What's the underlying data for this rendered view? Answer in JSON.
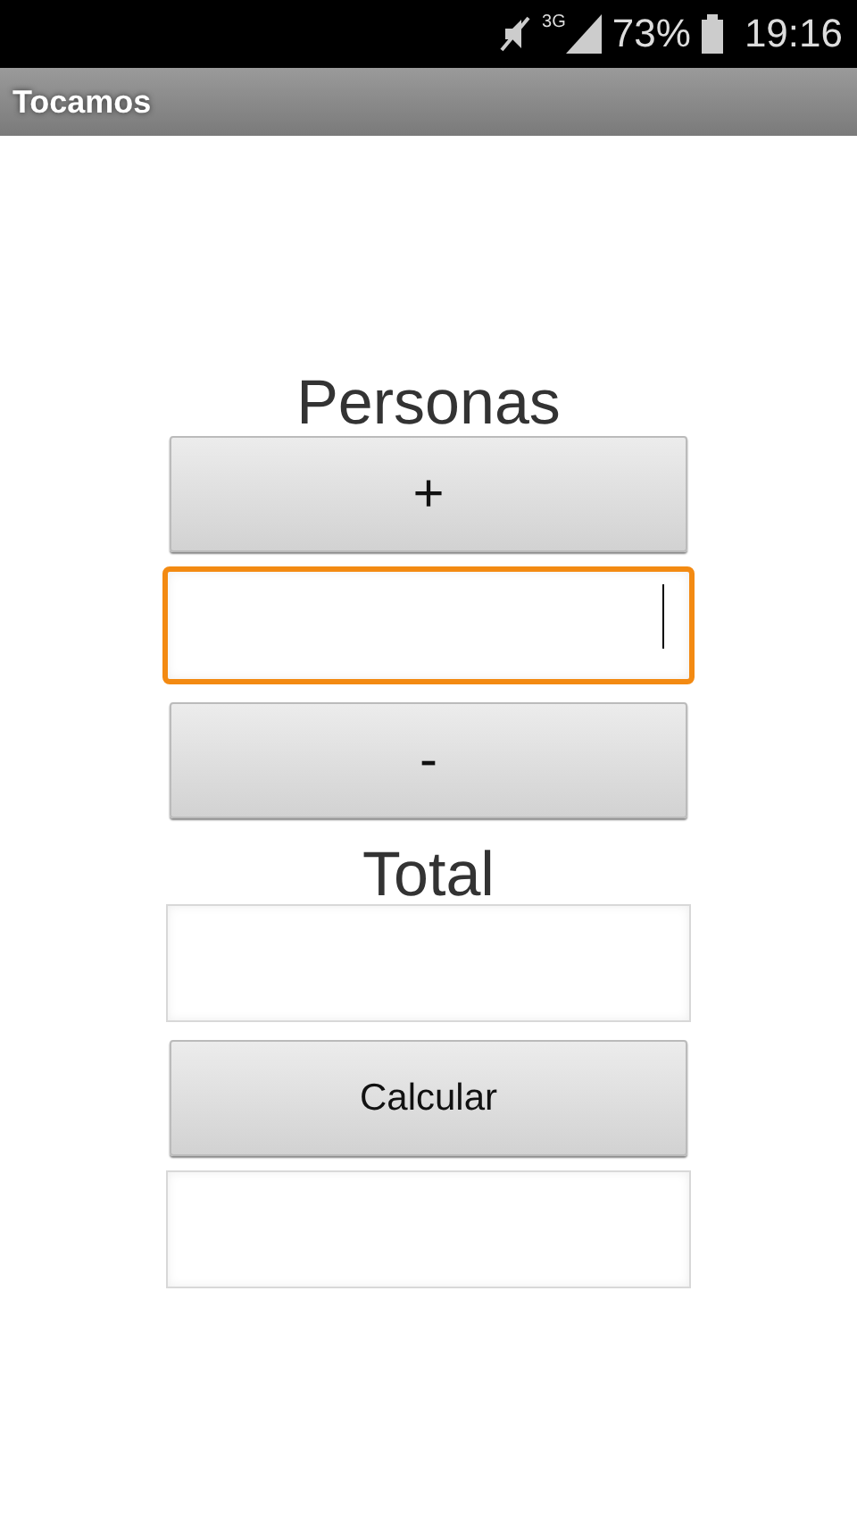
{
  "status_bar": {
    "network": "3G",
    "battery": "73%",
    "time": "19:16"
  },
  "title_bar": {
    "title": "Tocamos"
  },
  "items": [
    {
      "kind": "label",
      "text": "Personas"
    },
    {
      "kind": "button",
      "text": "+"
    },
    {
      "kind": "field",
      "focused": true
    },
    {
      "kind": "button",
      "text": "-"
    },
    {
      "kind": "label",
      "text": "Total"
    },
    {
      "kind": "field",
      "focused": false
    },
    {
      "kind": "button",
      "text": "Calcular",
      "small": true
    },
    {
      "kind": "field",
      "focused": false
    }
  ]
}
